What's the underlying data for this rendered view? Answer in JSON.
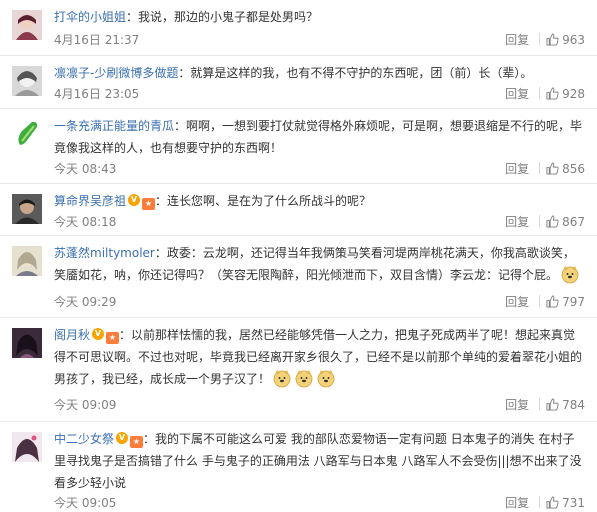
{
  "comments": [
    {
      "username": "打伞的小姐姐",
      "text": "我说，那边的小鬼子都是处男吗？",
      "time": "4月16日 21:37",
      "reply_label": "回复",
      "likes": "963",
      "avatar_color": "#8a3a4a"
    },
    {
      "username": "凛凛子-少刷微博多做题",
      "text": "就算是这样的我，也有不得不守护的东西呢，团（前）长（辈）。",
      "time": "4月16日 23:05",
      "reply_label": "回复",
      "likes": "928",
      "avatar_color": "#9a9a9a"
    },
    {
      "username": "一条充满正能量的青瓜",
      "text": "啊啊，一想到要打仗就觉得格外麻烦呢，可是啊，想要退缩是不行的呢，毕竟像我这样的人，也有想要守护的东西啊！",
      "time": "今天 08:43",
      "reply_label": "回复",
      "likes": "856",
      "avatar_color": "#3fae3f"
    },
    {
      "username": "算命界吴彦祖",
      "text": "连长您啊、是在为了什么所战斗的呢？",
      "time": "今天 08:18",
      "reply_label": "回复",
      "likes": "867",
      "avatar_color": "#3a3a3a"
    },
    {
      "username": "苏蓬然miltymoler",
      "text": "政委：云龙啊，还记得当年我俩策马笑看河堤两岸桃花满天，你我高歌谈笑，笑靥如花，呐，你还记得吗？（笑容无限陶醉，阳光倾泄而下，双目含情）李云龙：记得个屁。",
      "time": "今天 09:29",
      "reply_label": "回复",
      "likes": "797",
      "avatar_color": "#b0a890"
    },
    {
      "username": "阁月秋",
      "text": "以前那样怯懦的我，居然已经能够凭借一人之力，把鬼子死成两半了呢！想起来真觉得不可思议啊。不过也对呢，毕竟我已经离开家乡很久了，已经不是以前那个单纯的爱着翠花小姐的男孩了，我已经，成长成一个男子汉了！",
      "time": "今天 09:09",
      "reply_label": "回复",
      "likes": "784",
      "avatar_color": "#5a3a5a"
    },
    {
      "username": "中二少女祭",
      "text": "我的下属不可能这么可爱 我的部队恋爱物语一定有问题 日本鬼子的消失 在村子里寻找鬼子是否搞错了什么 手与鬼子的正确用法 八路军与日本鬼 八路军人不会受伤|||想不出来了没看多少轻小说",
      "time": "今天 09:05",
      "reply_label": "回复",
      "likes": "731",
      "avatar_color": "#4a3040"
    }
  ],
  "colors": {
    "username": "#3b6faf",
    "meta": "#808080",
    "divider": "#eaeaea",
    "vip_badge": "#f7a400",
    "level_badge": "#fa7d3c"
  }
}
